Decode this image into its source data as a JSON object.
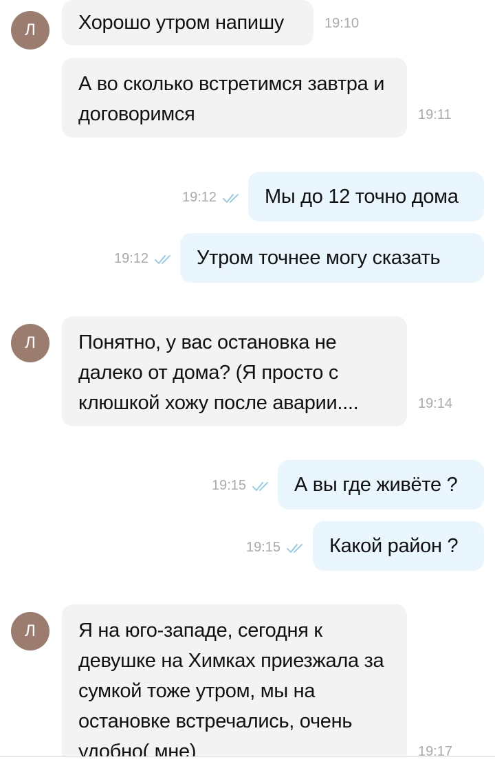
{
  "chat": {
    "avatar_letter": "Л",
    "avatar_color": "#9b7c6f",
    "accent_check_color": "#8dc7ea",
    "messages": [
      {
        "text": "Хорошо утром напишу",
        "time": "19:10"
      },
      {
        "text": "А во сколько встретимся завтра и договоримся",
        "time": "19:11"
      },
      {
        "text": "Мы до 12 точно дома",
        "time": "19:12"
      },
      {
        "text": "Утром точнее могу сказать",
        "time": "19:12"
      },
      {
        "text": "Понятно, у вас остановка не далеко от дома? (Я просто с клюшкой хожу после аварии....",
        "time": "19:14"
      },
      {
        "text": "А вы где живёте ?",
        "time": "19:15"
      },
      {
        "text": "Какой район ?",
        "time": "19:15"
      },
      {
        "text": "Я на юго-западе, сегодня к девушке на Химках приезжала за сумкой тоже утром, мы на остановке встречались, очень удобно( мне)",
        "time": "19:17"
      }
    ]
  }
}
